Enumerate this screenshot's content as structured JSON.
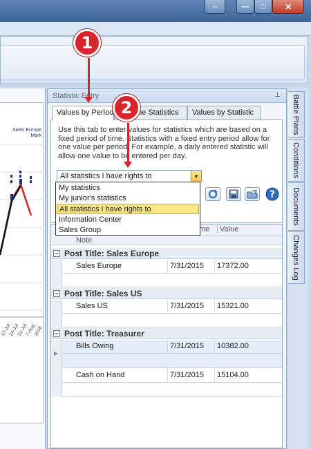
{
  "window": {
    "restore_glyph": "⇔",
    "min_glyph": "—",
    "max_glyph": "□",
    "close_glyph": "✕"
  },
  "chart": {
    "legend_series": "Sales Europe",
    "legend_sub": "Mark",
    "date_labels": [
      "17-Jul",
      "24-Jul",
      "31-Jul",
      "7-Aug",
      "2016"
    ]
  },
  "panel": {
    "title": "Statistic Entry",
    "pin_glyph": "⊥",
    "tabs": [
      "Values by Period",
      "me Statistics",
      "Values by Statistic"
    ],
    "description": "Use this tab to enter values for statistics which are based on a fixed period of time. Statistics with a fixed entry period allow for one value per period. For example, a daily entered statistic will allow one value to be entered per day.",
    "select": {
      "value": "All statistics I have rights to",
      "arrow": "▼"
    },
    "options": [
      "My statistics",
      "My junior's statistics",
      "All statistics I have rights to",
      "Information Center",
      "Sales Group"
    ],
    "tools": {
      "help_glyph": "?"
    }
  },
  "grid": {
    "headers": {
      "time": "me",
      "value": "Value",
      "note": "Note"
    },
    "groups": [
      {
        "title": "Post Title:  Sales Europe",
        "rows": [
          {
            "stat": "Sales Europe",
            "date": "7/31/2015",
            "value": "17372.00"
          }
        ]
      },
      {
        "title": "Post Title:  Sales US",
        "rows": [
          {
            "stat": "Sales US",
            "date": "7/31/2015",
            "value": "15321.00"
          }
        ]
      },
      {
        "title": "Post Title:  Treasurer",
        "rows": [
          {
            "stat": "Bills Owing",
            "date": "7/31/2015",
            "value": "10382.00"
          },
          {
            "stat": "Cash on Hand",
            "date": "7/31/2015",
            "value": "15104.00"
          }
        ]
      }
    ]
  },
  "right_tabs": [
    "Battle Plans",
    "Conditions",
    "Documents",
    "Changes Log"
  ],
  "callouts": [
    "1",
    "2"
  ],
  "colors": {
    "callout": "#d8242a",
    "selected_option": "#fde684",
    "accent": "#3d6496"
  }
}
